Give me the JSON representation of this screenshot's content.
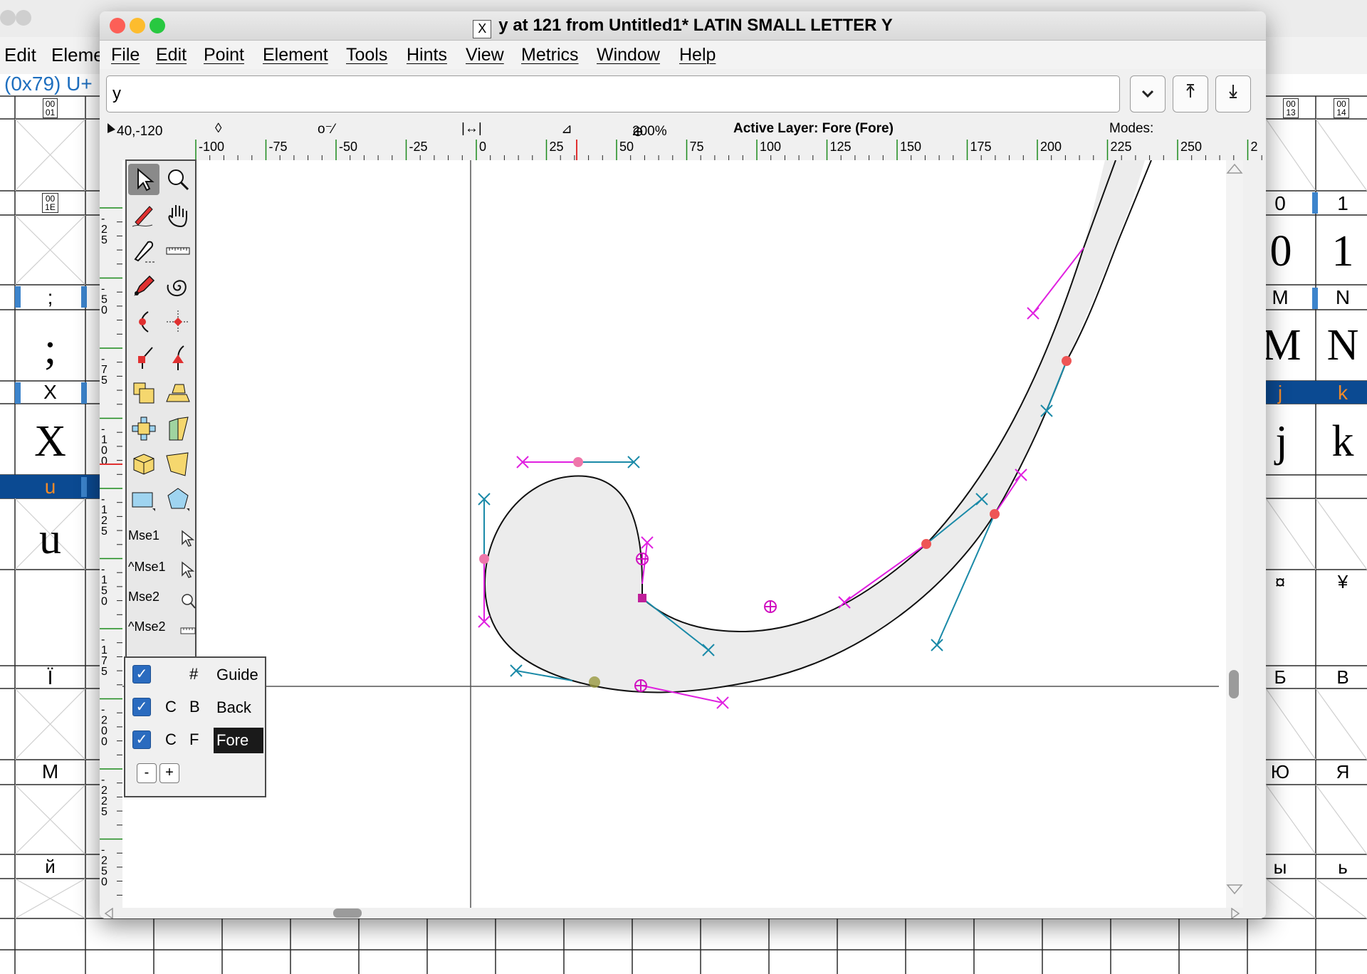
{
  "background_window": {
    "menu": [
      "Edit",
      "Eleme"
    ],
    "code_label": "(0x79) U+",
    "left_cells": [
      {
        "label": "00\n01",
        "glyph": ""
      },
      {
        "label": "00\n1E",
        "glyph": ""
      },
      {
        "label": ";",
        "glyph": ";"
      },
      {
        "label": "X",
        "glyph": "X"
      },
      {
        "label": "u",
        "glyph": "u",
        "selected": true
      },
      {
        "label": "Ï",
        "glyph": ""
      },
      {
        "label": "M",
        "glyph": ""
      },
      {
        "label": "й",
        "glyph": ""
      }
    ],
    "right_labels": [
      "00\n13",
      "00\n14",
      "0",
      "1",
      "M",
      "N",
      "j",
      "k",
      "¤",
      "¥",
      "Б",
      "В",
      "Ю",
      "Я",
      "ы",
      "ь"
    ],
    "right_glyphs": [
      "0",
      "1",
      "M",
      "N",
      "j",
      "k"
    ]
  },
  "glyph_window": {
    "title": "y at 121 from Untitled1* LATIN SMALL LETTER Y",
    "title_icon": "X",
    "menu": [
      "File",
      "Edit",
      "Point",
      "Element",
      "Tools",
      "Hints",
      "View",
      "Metrics",
      "Window",
      "Help"
    ],
    "search_value": "y",
    "buttons": {
      "dropdown": "chevron-down-icon",
      "prev": "prev-word-icon",
      "next": "next-word-icon"
    },
    "info": {
      "coords": "40,-120",
      "zoom": "200%",
      "active_layer": "Active Layer: Fore (Fore)",
      "modes": "Modes:"
    },
    "h_ruler_labels": [
      "-100",
      "-75",
      "-50",
      "-25",
      "0",
      "25",
      "50",
      "75",
      "100",
      "125",
      "150",
      "175",
      "200",
      "225",
      "250",
      "2"
    ],
    "v_ruler_labels": [
      "25",
      "50",
      "75",
      "100",
      "125",
      "150",
      "175",
      "200",
      "225",
      "250"
    ],
    "tools": [
      "pointer-icon",
      "magnify-icon",
      "freehand-icon",
      "scroll-hand-icon",
      "knife-icon",
      "ruler-icon",
      "pen-icon",
      "spiro-icon",
      "curve-point-icon",
      "hv-curve-point-icon",
      "corner-point-icon",
      "tangent-point-icon",
      "scale-icon",
      "flip-icon",
      "rotate-icon",
      "skew-icon",
      "3d-rotate-icon",
      "perspective-icon",
      "rectangle-icon",
      "polygon-icon"
    ],
    "mouse_rows": [
      {
        "label": "Mse1",
        "icon": "pointer-icon"
      },
      {
        "label": "^Mse1",
        "icon": "pointer-icon"
      },
      {
        "label": "Mse2",
        "icon": "magnify-icon"
      },
      {
        "label": "^Mse2",
        "icon": "ruler-icon"
      }
    ],
    "layers": [
      {
        "checked": true,
        "c1": "",
        "c2": "#",
        "name": "Guide",
        "active": false
      },
      {
        "checked": true,
        "c1": "C",
        "c2": "B",
        "name": "Back",
        "active": false
      },
      {
        "checked": true,
        "c1": "C",
        "c2": "F",
        "name": "Fore",
        "active": true
      }
    ],
    "layer_buttons": [
      "-",
      "+"
    ]
  },
  "colors": {
    "traffic_red": "#fc5f57",
    "traffic_yellow": "#fdbc2e",
    "traffic_green": "#28c840",
    "control_magenta": "#e020e0",
    "control_teal": "#1a8aa8",
    "point_red": "#ee5555",
    "selection_blue": "#0b4a92",
    "ruler_green": "#1b8a1b"
  }
}
